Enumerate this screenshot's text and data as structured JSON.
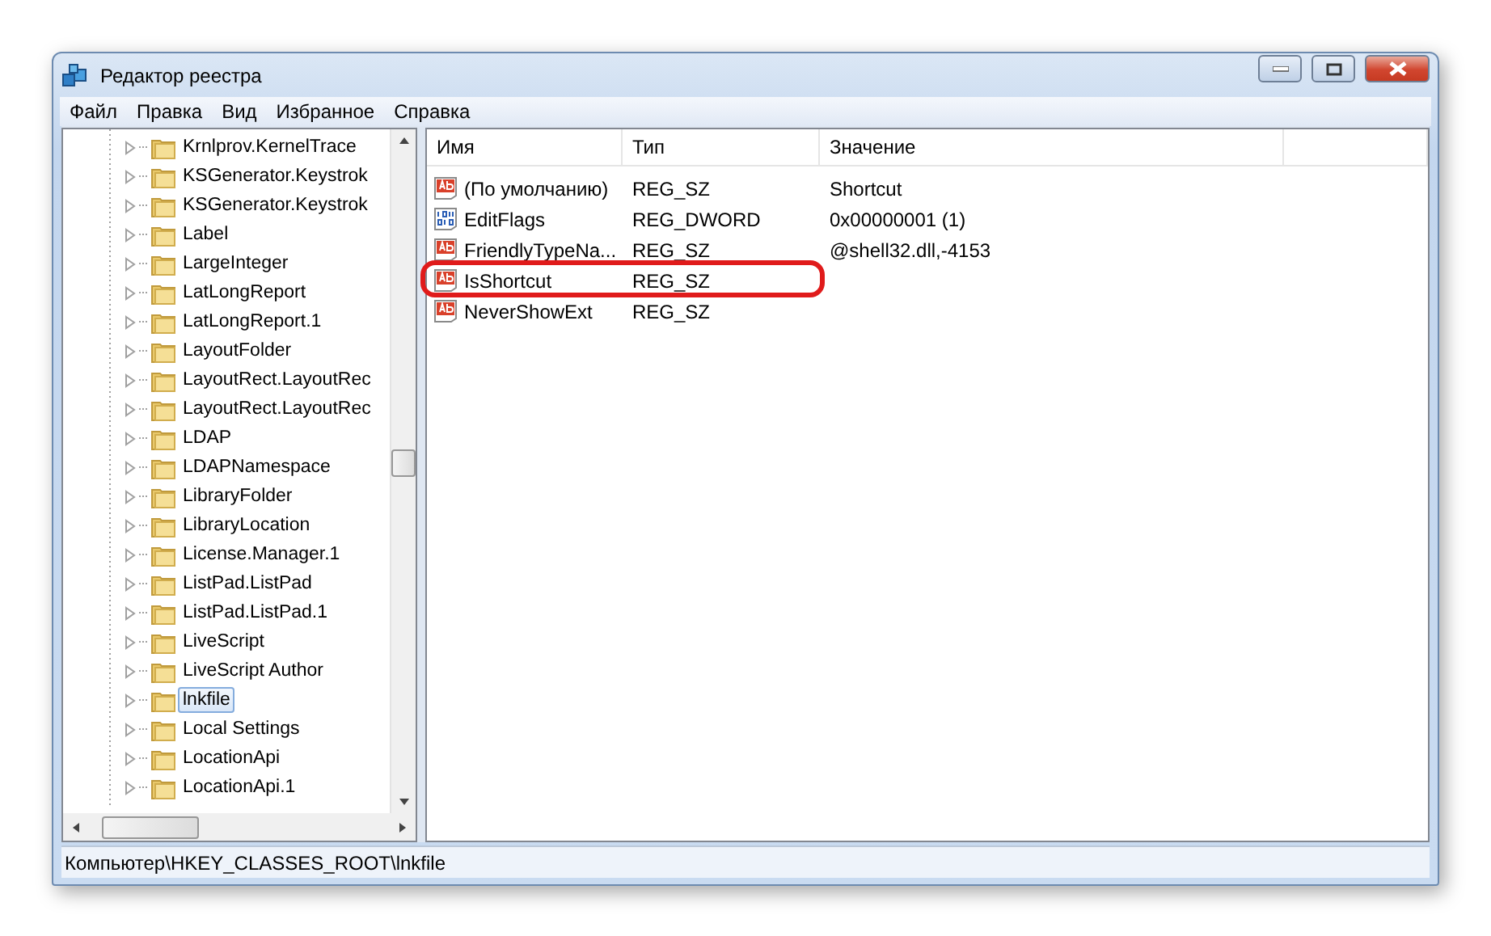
{
  "window": {
    "title": "Редактор реестра"
  },
  "menu": [
    "Файл",
    "Правка",
    "Вид",
    "Избранное",
    "Справка"
  ],
  "tree": {
    "items": [
      {
        "label": "Krnlprov.KernelTrace",
        "selected": false
      },
      {
        "label": "KSGenerator.Keystrok",
        "selected": false
      },
      {
        "label": "KSGenerator.Keystrok",
        "selected": false
      },
      {
        "label": "Label",
        "selected": false
      },
      {
        "label": "LargeInteger",
        "selected": false
      },
      {
        "label": "LatLongReport",
        "selected": false
      },
      {
        "label": "LatLongReport.1",
        "selected": false
      },
      {
        "label": "LayoutFolder",
        "selected": false
      },
      {
        "label": "LayoutRect.LayoutRec",
        "selected": false
      },
      {
        "label": "LayoutRect.LayoutRec",
        "selected": false
      },
      {
        "label": "LDAP",
        "selected": false
      },
      {
        "label": "LDAPNamespace",
        "selected": false
      },
      {
        "label": "LibraryFolder",
        "selected": false
      },
      {
        "label": "LibraryLocation",
        "selected": false
      },
      {
        "label": "License.Manager.1",
        "selected": false
      },
      {
        "label": "ListPad.ListPad",
        "selected": false
      },
      {
        "label": "ListPad.ListPad.1",
        "selected": false
      },
      {
        "label": "LiveScript",
        "selected": false
      },
      {
        "label": "LiveScript Author",
        "selected": false
      },
      {
        "label": "lnkfile",
        "selected": true
      },
      {
        "label": "Local Settings",
        "selected": false
      },
      {
        "label": "LocationApi",
        "selected": false
      },
      {
        "label": "LocationApi.1",
        "selected": false
      }
    ]
  },
  "table": {
    "columns": [
      "Имя",
      "Тип",
      "Значение"
    ],
    "rows": [
      {
        "kind": "string",
        "name": "(По умолчанию)",
        "type": "REG_SZ",
        "value": "Shortcut",
        "highlighted": false
      },
      {
        "kind": "binary",
        "name": "EditFlags",
        "type": "REG_DWORD",
        "value": "0x00000001 (1)",
        "highlighted": false
      },
      {
        "kind": "string",
        "name": "FriendlyTypeNa...",
        "type": "REG_SZ",
        "value": "@shell32.dll,-4153",
        "highlighted": false
      },
      {
        "kind": "string",
        "name": "IsShortcut",
        "type": "REG_SZ",
        "highlighted": true
      },
      {
        "kind": "string",
        "name": "NeverShowExt",
        "type": "REG_SZ",
        "highlighted": false
      }
    ]
  },
  "status_bar": "Компьютер\\HKEY_CLASSES_ROOT\\lnkfile"
}
